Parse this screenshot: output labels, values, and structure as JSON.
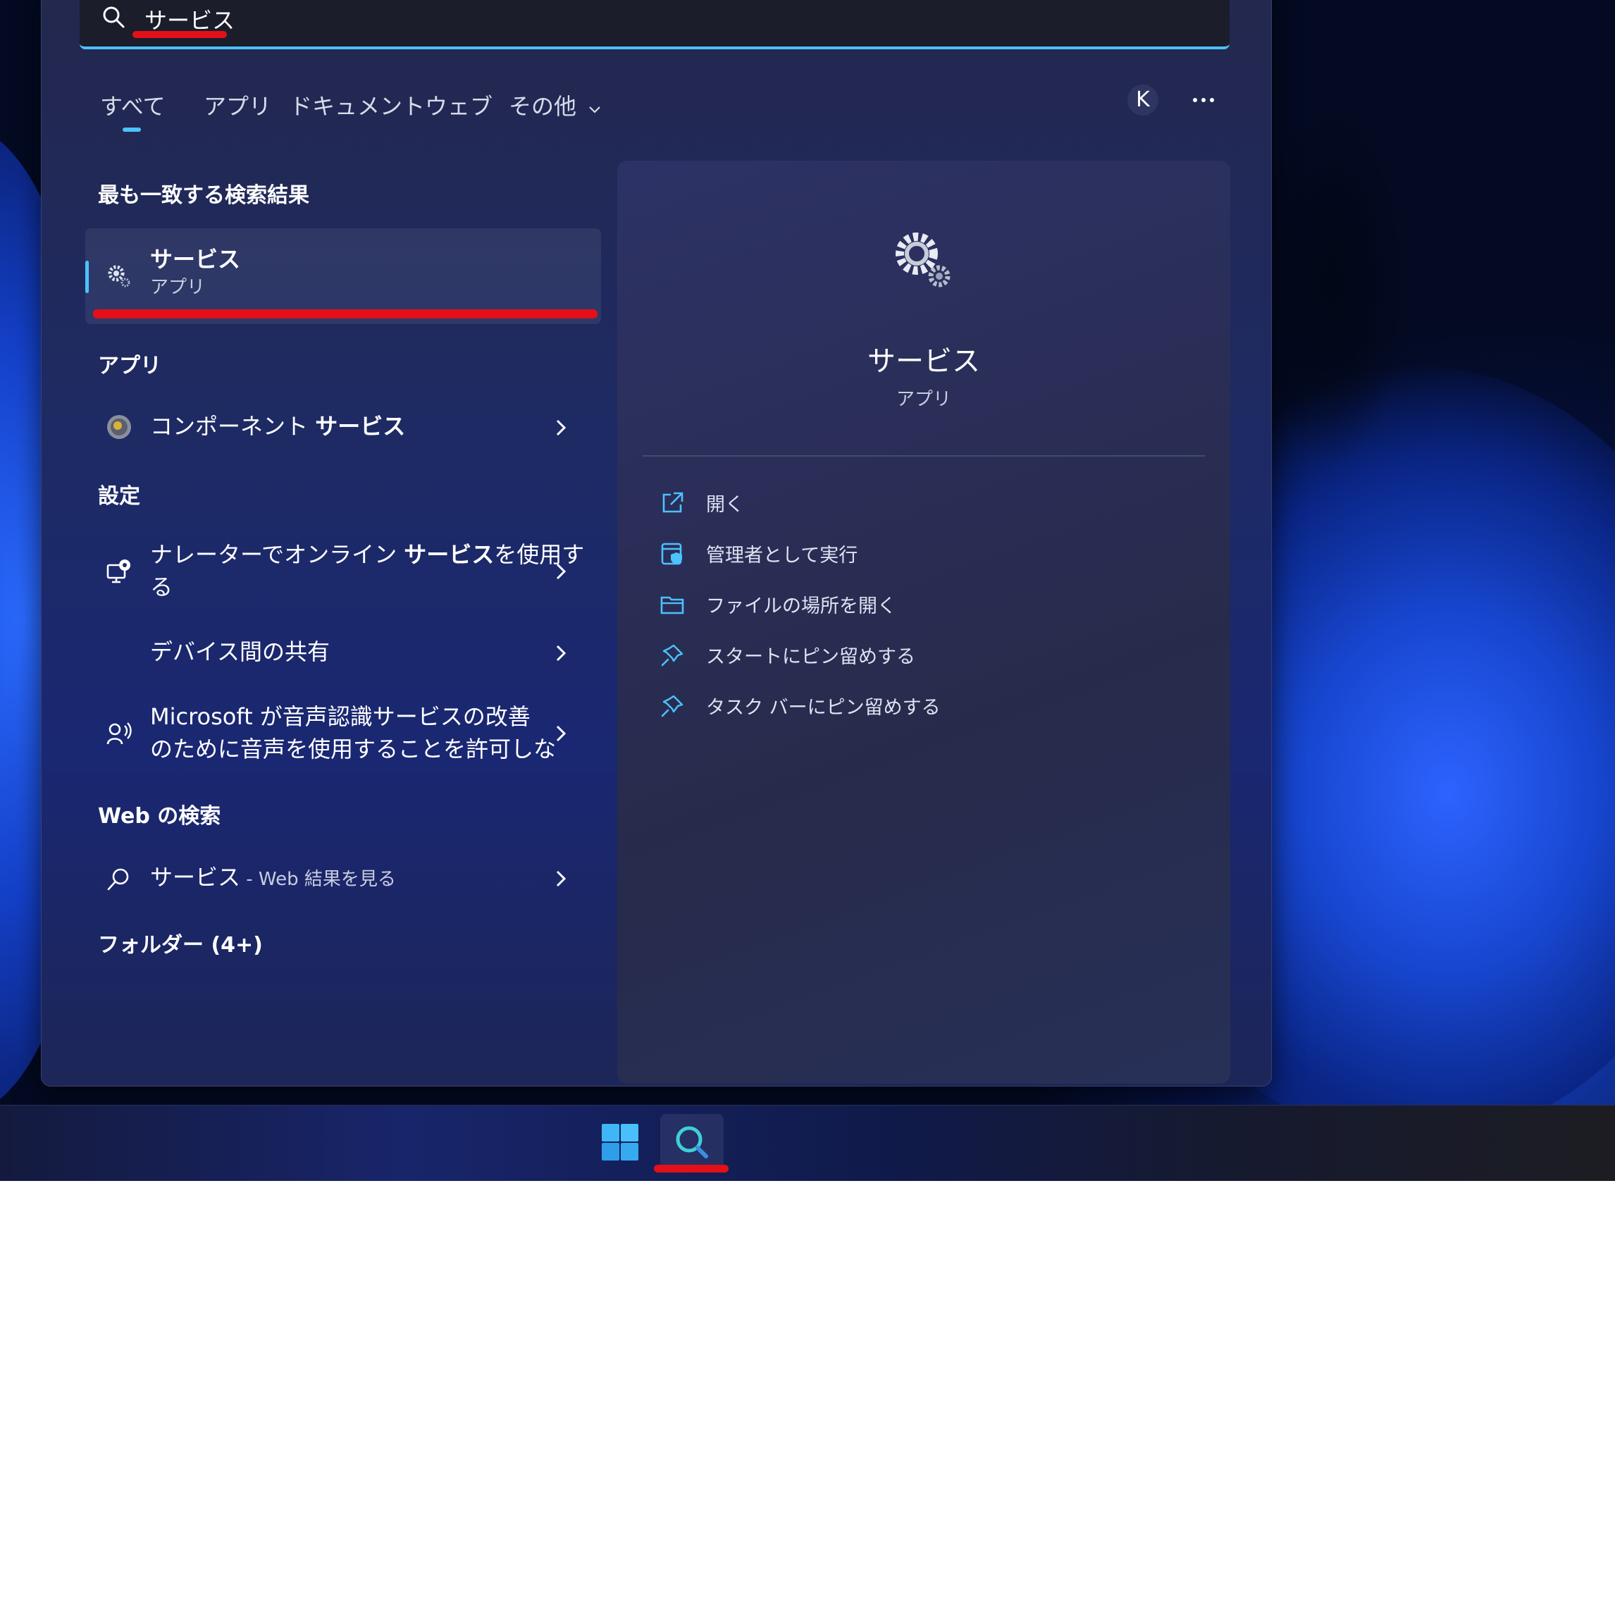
{
  "search": {
    "query": "サービス"
  },
  "tabs": [
    {
      "label": "すべて",
      "selected": true
    },
    {
      "label": "アプリ"
    },
    {
      "label": "ドキュメント"
    },
    {
      "label": "ウェブ"
    },
    {
      "label": "その他"
    }
  ],
  "account": {
    "initial": "K"
  },
  "results": {
    "best_match_heading": "最も一致する検索結果",
    "best_match": {
      "title": "サービス",
      "subtitle": "アプリ"
    },
    "apps_heading": "アプリ",
    "apps": [
      {
        "prefix": "コンポーネント ",
        "highlight": "サービス",
        "suffix": ""
      }
    ],
    "settings_heading": "設定",
    "settings": [
      {
        "line1_prefix": "ナレーターでオンライン ",
        "line1_highlight": "サービス",
        "line1_suffix": "を使用す",
        "line2": "る"
      },
      {
        "line1": "デバイス間の共有"
      },
      {
        "line1": "Microsoft が音声認識サービスの改善",
        "line2": "のために音声を使用することを許可しな"
      }
    ],
    "web_heading": "Web の検索",
    "web": {
      "query": "サービス",
      "suffix": " - Web 結果を見る"
    },
    "folders_heading": "フォルダー (4+)"
  },
  "details": {
    "title": "サービス",
    "subtitle": "アプリ",
    "actions": [
      {
        "label": "開く",
        "icon": "open-external-icon"
      },
      {
        "label": "管理者として実行",
        "icon": "shield-admin-icon"
      },
      {
        "label": "ファイルの場所を開く",
        "icon": "folder-icon"
      },
      {
        "label": "スタートにピン留めする",
        "icon": "pin-icon"
      },
      {
        "label": "タスク バーにピン留めする",
        "icon": "pin-icon"
      }
    ]
  },
  "colors": {
    "accent": "#4cc2ff",
    "annotation_red": "#e31018"
  }
}
